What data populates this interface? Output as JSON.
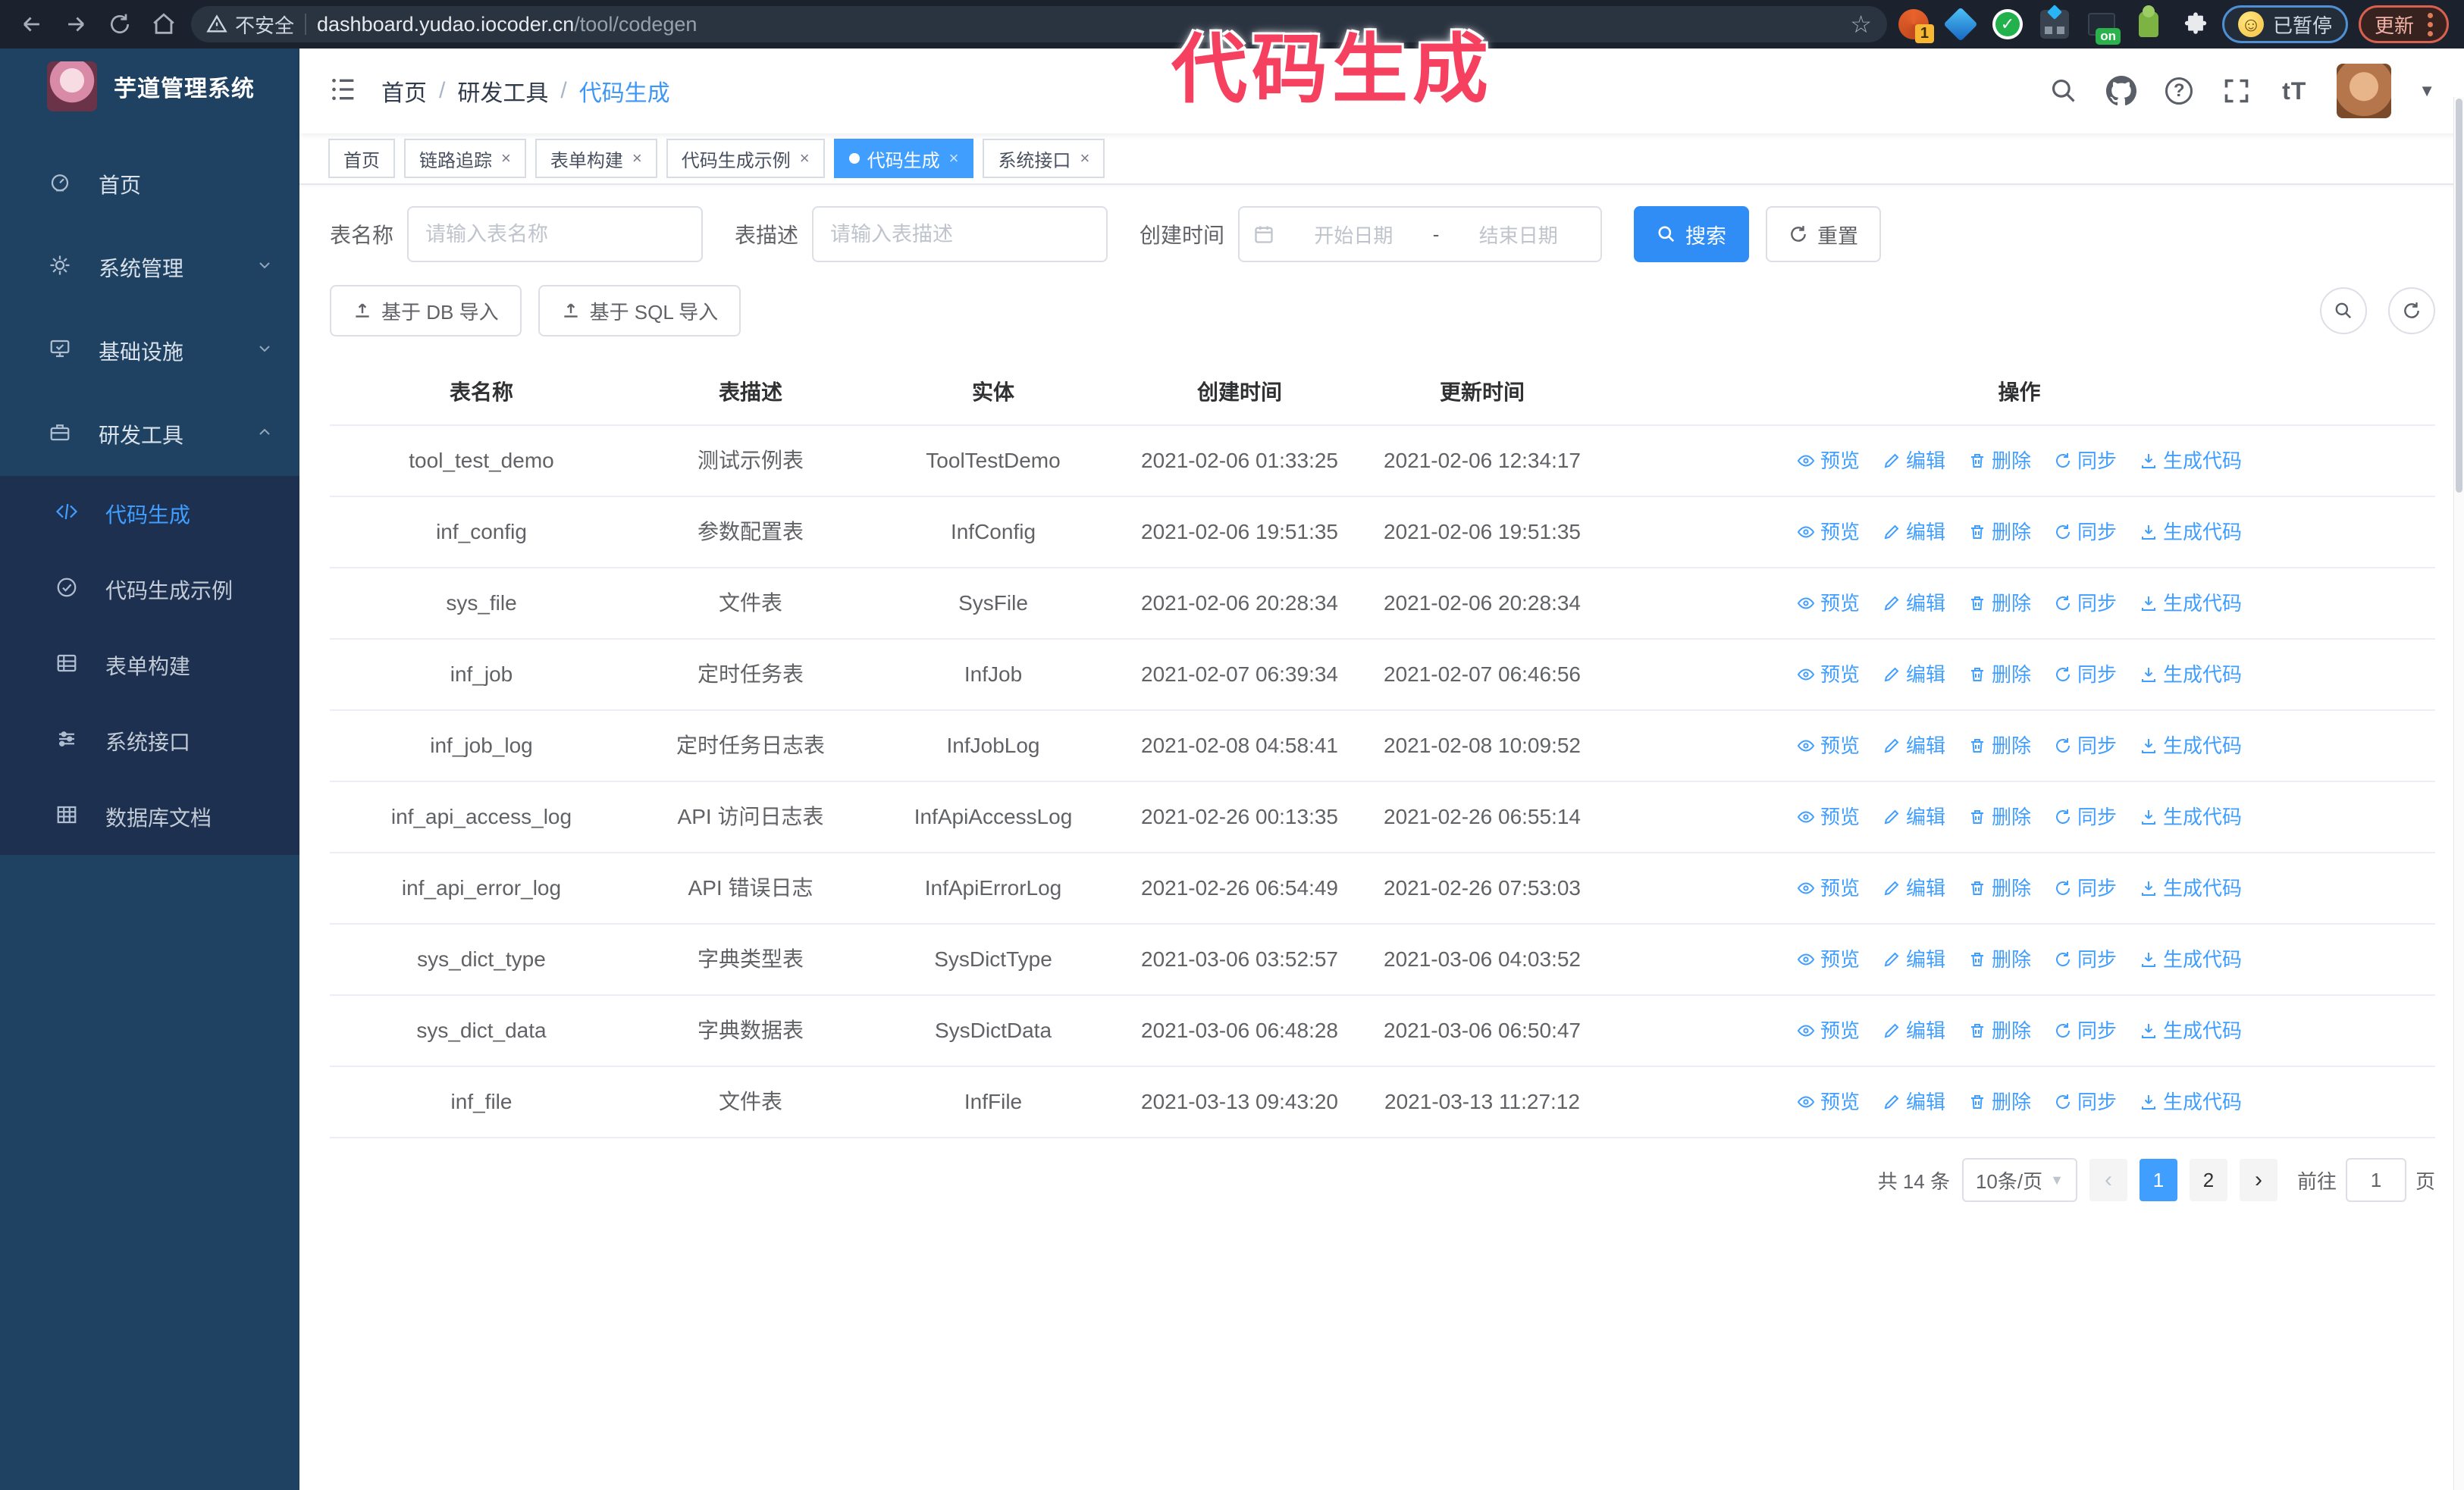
{
  "accent_color": "#409eff",
  "browser": {
    "security_label": "不安全",
    "url_host": "dashboard.yudao.iocoder.cn",
    "url_path": "/tool/codegen",
    "extensions": [
      "tampermonkey-extension",
      "diamond-extension",
      "green-check-extension",
      "grid-extension",
      "switch-on-extension",
      "robot-extension",
      "puzzle-extension"
    ],
    "tampermonkey_badge": "1",
    "on_badge": "on",
    "paused_badge": "已暂停",
    "update_button": "更新"
  },
  "annotation": {
    "text": "代码生成",
    "color": "#f5415f"
  },
  "sidebar": {
    "logo_title": "芋道管理系统",
    "menu": [
      {
        "label": "首页",
        "icon": "dashboard-icon",
        "expandable": false,
        "expanded": false,
        "active": false
      },
      {
        "label": "系统管理",
        "icon": "gear-icon",
        "expandable": true,
        "expanded": false,
        "active": false
      },
      {
        "label": "基础设施",
        "icon": "infrastructure-icon",
        "expandable": true,
        "expanded": false,
        "active": false
      },
      {
        "label": "研发工具",
        "icon": "devtools-icon",
        "expandable": true,
        "expanded": true,
        "active": false
      }
    ],
    "submenu": [
      {
        "label": "代码生成",
        "icon": "code-icon",
        "active": true
      },
      {
        "label": "代码生成示例",
        "icon": "example-icon",
        "active": false
      },
      {
        "label": "表单构建",
        "icon": "form-build-icon",
        "active": false
      },
      {
        "label": "系统接口",
        "icon": "api-icon",
        "active": false
      },
      {
        "label": "数据库文档",
        "icon": "database-doc-icon",
        "active": false
      }
    ]
  },
  "navbar": {
    "breadcrumb": [
      "首页",
      "研发工具",
      "代码生成"
    ],
    "separator": "/"
  },
  "tags_view": [
    {
      "label": "首页",
      "closable": false,
      "active": false
    },
    {
      "label": "链路追踪",
      "closable": true,
      "active": false
    },
    {
      "label": "表单构建",
      "closable": true,
      "active": false
    },
    {
      "label": "代码生成示例",
      "closable": true,
      "active": false
    },
    {
      "label": "代码生成",
      "closable": true,
      "active": true
    },
    {
      "label": "系统接口",
      "closable": true,
      "active": false
    }
  ],
  "search_form": {
    "name_label": "表名称",
    "name_placeholder": "请输入表名称",
    "desc_label": "表描述",
    "desc_placeholder": "请输入表描述",
    "time_label": "创建时间",
    "start_placeholder": "开始日期",
    "range_separator": "-",
    "end_placeholder": "结束日期",
    "search_button": "搜索",
    "reset_button": "重置"
  },
  "toolbar": {
    "db_import": "基于 DB 导入",
    "sql_import": "基于 SQL 导入"
  },
  "table": {
    "columns": [
      "表名称",
      "表描述",
      "实体",
      "创建时间",
      "更新时间",
      "操作"
    ],
    "actions": [
      "预览",
      "编辑",
      "删除",
      "同步",
      "生成代码"
    ],
    "rows": [
      {
        "name": "tool_test_demo",
        "desc": "测试示例表",
        "entity": "ToolTestDemo",
        "created": "2021-02-06 01:33:25",
        "updated": "2021-02-06 12:34:17"
      },
      {
        "name": "inf_config",
        "desc": "参数配置表",
        "entity": "InfConfig",
        "created": "2021-02-06 19:51:35",
        "updated": "2021-02-06 19:51:35"
      },
      {
        "name": "sys_file",
        "desc": "文件表",
        "entity": "SysFile",
        "created": "2021-02-06 20:28:34",
        "updated": "2021-02-06 20:28:34"
      },
      {
        "name": "inf_job",
        "desc": "定时任务表",
        "entity": "InfJob",
        "created": "2021-02-07 06:39:34",
        "updated": "2021-02-07 06:46:56"
      },
      {
        "name": "inf_job_log",
        "desc": "定时任务日志表",
        "entity": "InfJobLog",
        "created": "2021-02-08 04:58:41",
        "updated": "2021-02-08 10:09:52"
      },
      {
        "name": "inf_api_access_log",
        "desc": "API 访问日志表",
        "entity": "InfApiAccessLog",
        "created": "2021-02-26 00:13:35",
        "updated": "2021-02-26 06:55:14"
      },
      {
        "name": "inf_api_error_log",
        "desc": "API 错误日志",
        "entity": "InfApiErrorLog",
        "created": "2021-02-26 06:54:49",
        "updated": "2021-02-26 07:53:03"
      },
      {
        "name": "sys_dict_type",
        "desc": "字典类型表",
        "entity": "SysDictType",
        "created": "2021-03-06 03:52:57",
        "updated": "2021-03-06 04:03:52"
      },
      {
        "name": "sys_dict_data",
        "desc": "字典数据表",
        "entity": "SysDictData",
        "created": "2021-03-06 06:48:28",
        "updated": "2021-03-06 06:50:47"
      },
      {
        "name": "inf_file",
        "desc": "文件表",
        "entity": "InfFile",
        "created": "2021-03-13 09:43:20",
        "updated": "2021-03-13 11:27:12"
      }
    ]
  },
  "pagination": {
    "total": "共 14 条",
    "page_size": "10条/页",
    "pages": [
      "1",
      "2"
    ],
    "active_page": "1",
    "goto_label": "前往",
    "goto_value": "1",
    "goto_suffix": "页"
  }
}
